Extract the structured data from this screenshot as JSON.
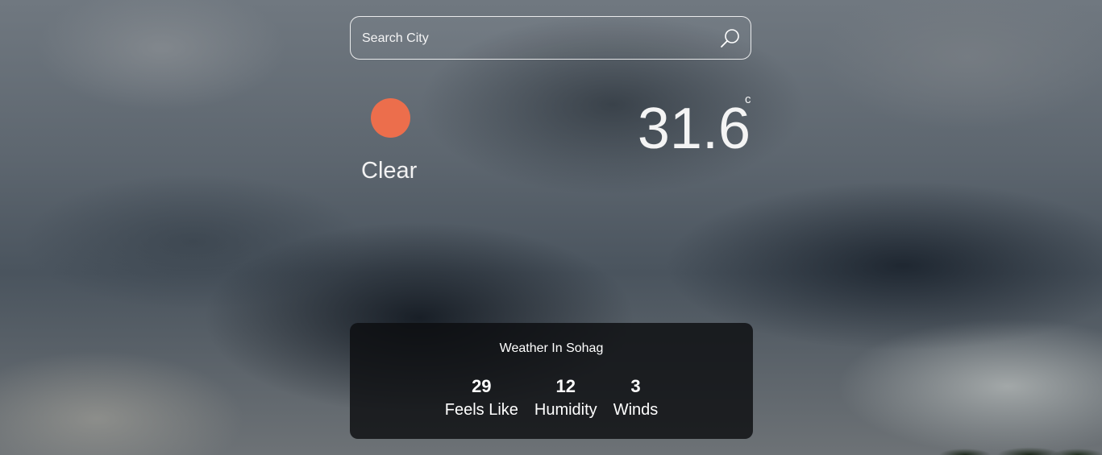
{
  "search": {
    "placeholder": "Search City",
    "value": "",
    "icon": "search-icon"
  },
  "current": {
    "condition": "Clear",
    "icon": "sun-icon",
    "icon_color": "#ec6e4c",
    "temperature": "31.6",
    "unit": "c"
  },
  "details": {
    "title": "Weather In Sohag",
    "stats": [
      {
        "value": "29",
        "label": "Feels Like"
      },
      {
        "value": "12",
        "label": "Humidity"
      },
      {
        "value": "3",
        "label": "Winds"
      }
    ]
  }
}
